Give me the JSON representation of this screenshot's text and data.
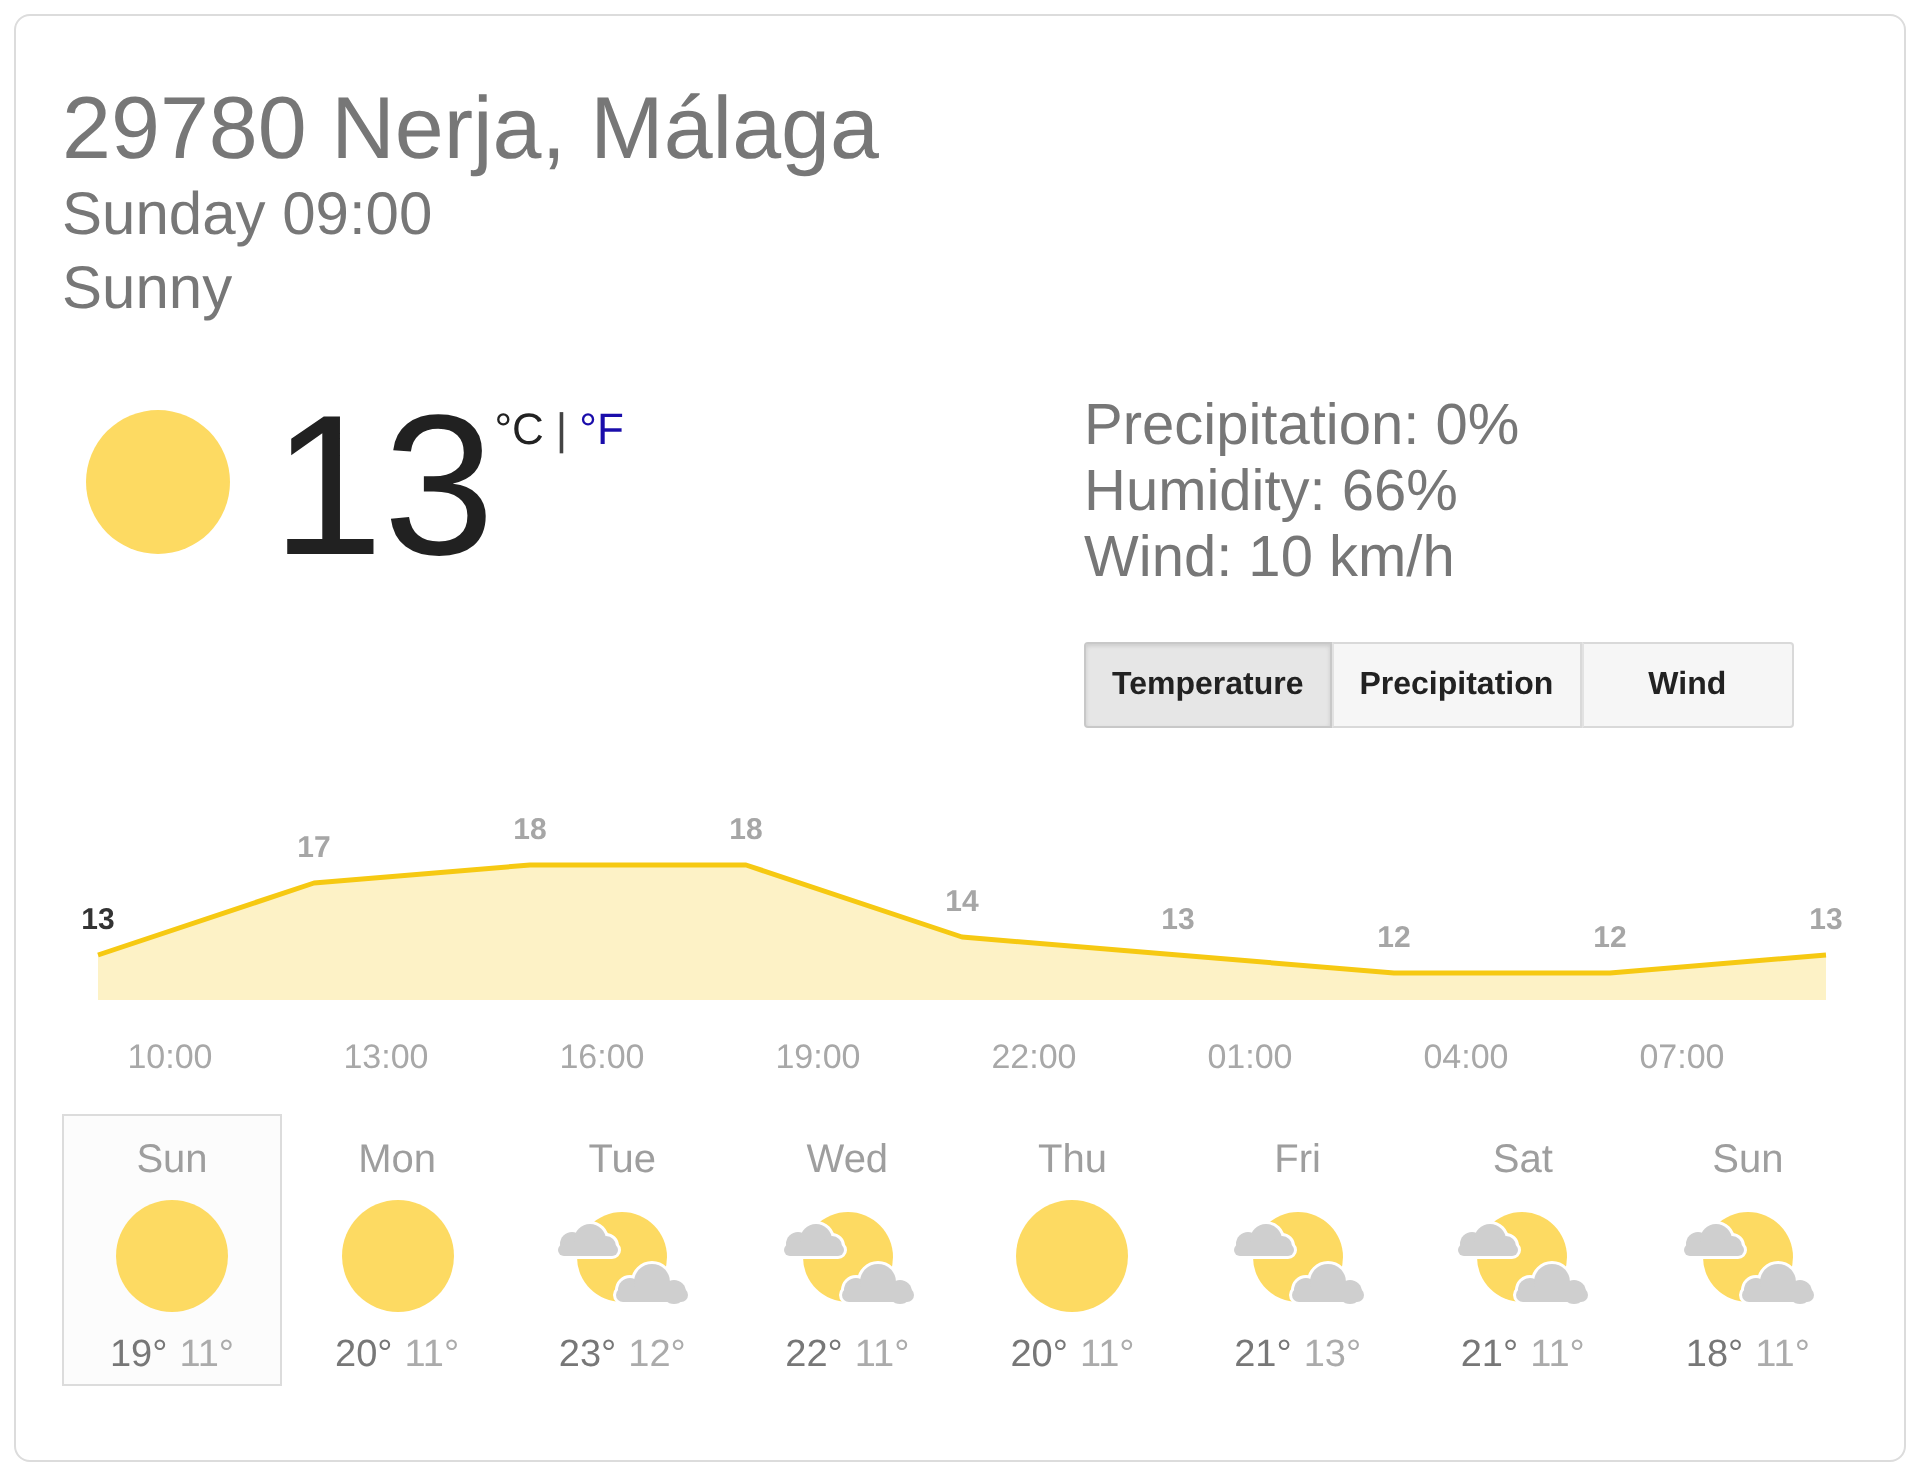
{
  "location": {
    "title": "29780 Nerja, Málaga",
    "datetime": "Sunday 09:00",
    "condition": "Sunny"
  },
  "current": {
    "temperature": "13",
    "units": [
      {
        "label": "°C",
        "selected": true
      },
      {
        "label": "°F",
        "selected": false
      }
    ],
    "unit_separator": "|",
    "details": [
      "Precipitation: 0%",
      "Humidity: 66%",
      "Wind: 10 km/h"
    ]
  },
  "chart_tabs": [
    {
      "label": "Temperature",
      "selected": true
    },
    {
      "label": "Precipitation",
      "selected": false
    },
    {
      "label": "Wind",
      "selected": false
    }
  ],
  "chart": {
    "chart_data": {
      "type": "area",
      "categories": [
        null,
        null,
        null,
        null,
        null,
        null,
        null,
        null,
        null
      ],
      "series": [
        {
          "color": "#f6c912",
          "values": [
            13,
            17,
            18,
            18,
            14,
            13,
            12,
            12,
            13
          ]
        }
      ],
      "data_labels": true
    },
    "time_labels": [
      "10:00",
      "13:00",
      "16:00",
      "19:00",
      "22:00",
      "01:00",
      "04:00",
      "07:00"
    ]
  },
  "days": [
    {
      "day": "Sun",
      "kind": "sun",
      "high": "19°",
      "low": "11°",
      "selected": true
    },
    {
      "day": "Mon",
      "kind": "sun",
      "high": "20°",
      "low": "11°",
      "selected": false
    },
    {
      "day": "Tue",
      "kind": "mixed",
      "high": "23°",
      "low": "12°",
      "selected": false
    },
    {
      "day": "Wed",
      "kind": "mixed",
      "high": "22°",
      "low": "11°",
      "selected": false
    },
    {
      "day": "Thu",
      "kind": "sun",
      "high": "20°",
      "low": "11°",
      "selected": false
    },
    {
      "day": "Fri",
      "kind": "mixed",
      "high": "21°",
      "low": "13°",
      "selected": false
    },
    {
      "day": "Sat",
      "kind": "mixed",
      "high": "21°",
      "low": "11°",
      "selected": false
    },
    {
      "day": "Sun",
      "kind": "mixed",
      "high": "18°",
      "low": "11°",
      "selected": false
    }
  ]
}
